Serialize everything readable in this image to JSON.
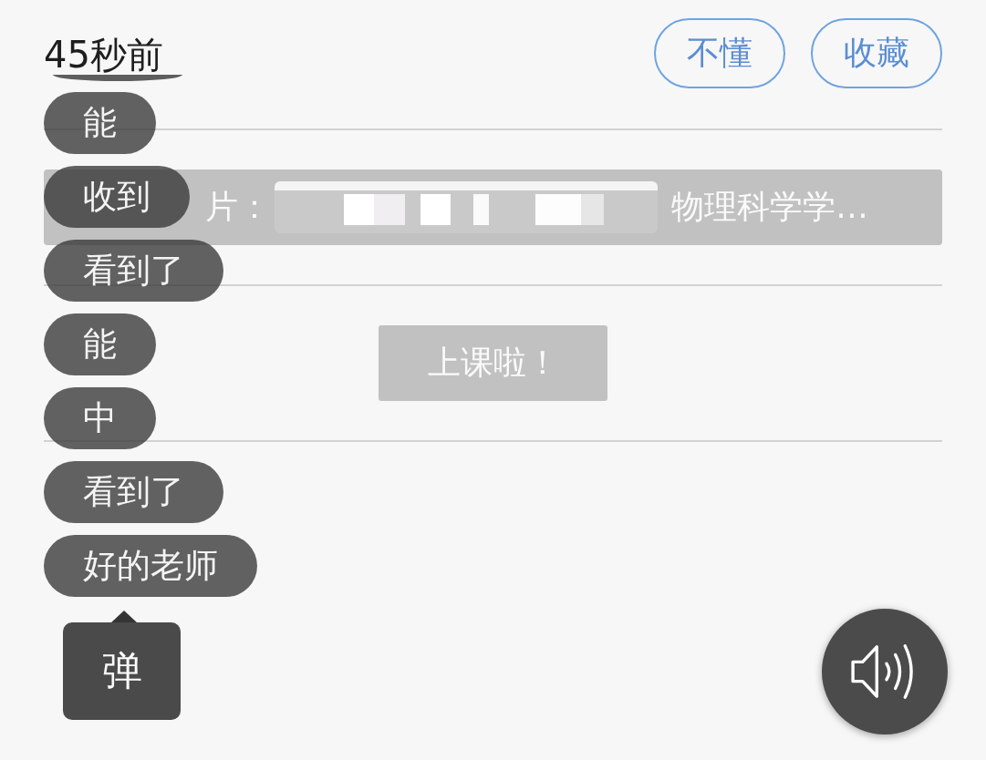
{
  "header": {
    "time": "45秒前",
    "buttons": [
      {
        "label": "不懂"
      },
      {
        "label": "收藏"
      }
    ]
  },
  "feed": [
    {
      "kind": "slide",
      "prefix": "片：",
      "title": "物理科学学…"
    },
    {
      "kind": "notice",
      "text": "上课啦！"
    }
  ],
  "danmaku": {
    "items": [
      "能",
      "收到",
      "看到了",
      "能",
      "中",
      "看到了",
      "好的老师"
    ],
    "button": {
      "label": "弹"
    }
  }
}
